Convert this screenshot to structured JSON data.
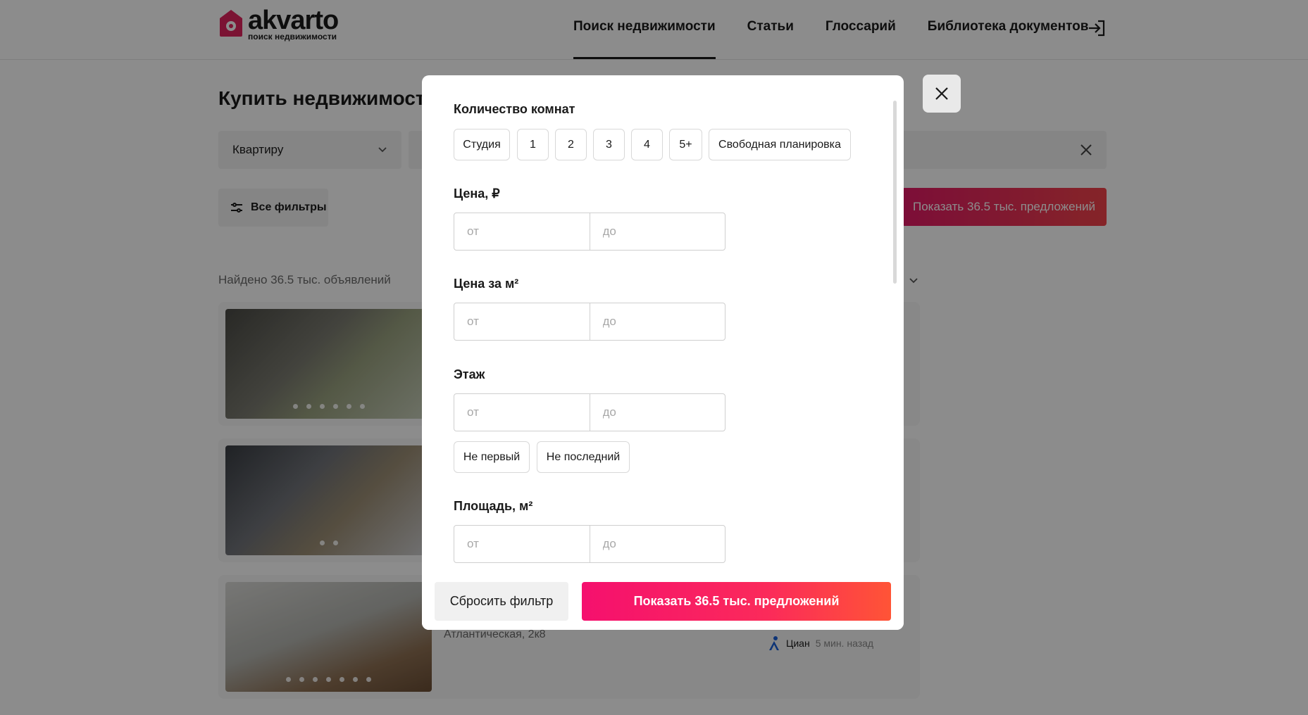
{
  "header": {
    "logo_name": "akvarto",
    "logo_sub": "поиск недвижимости",
    "nav": [
      {
        "label": "Поиск недвижимости",
        "active": true
      },
      {
        "label": "Статьи"
      },
      {
        "label": "Глоссарий"
      },
      {
        "label": "Библиотека документов"
      }
    ],
    "login_icon": "login-icon"
  },
  "page": {
    "title": "Купить недвижимость",
    "type_select": "Квартиру",
    "all_filters": "Все фильтры",
    "show_button": "Показать 36.5 тыс. предложений",
    "found": "Найдено 36.5 тыс. объявлений"
  },
  "listings": [
    {
      "address": "",
      "source": "",
      "time": ""
    },
    {
      "address": "",
      "source": "",
      "time": ""
    },
    {
      "address": "Атлантическая, 2к8",
      "source": "Циан",
      "time": "5 мин. назад"
    }
  ],
  "modal": {
    "rooms": {
      "label": "Количество комнат",
      "options": [
        "Студия",
        "1",
        "2",
        "3",
        "4",
        "5+",
        "Свободная планировка"
      ]
    },
    "price": {
      "label": "Цена, ₽",
      "from": "от",
      "to": "до"
    },
    "price_m2": {
      "label": "Цена за м²",
      "from": "от",
      "to": "до"
    },
    "floor": {
      "label": "Этаж",
      "from": "от",
      "to": "до",
      "not_first": "Не первый",
      "not_last": "Не последний"
    },
    "area": {
      "label": "Площадь, м²",
      "from": "от",
      "to": "до"
    },
    "reset": "Сбросить фильтр",
    "show": "Показать 36.5 тыс. предложений"
  },
  "colors": {
    "accent": "#f5106e",
    "accent_end": "#ff5436",
    "logo": "#e0245e"
  }
}
